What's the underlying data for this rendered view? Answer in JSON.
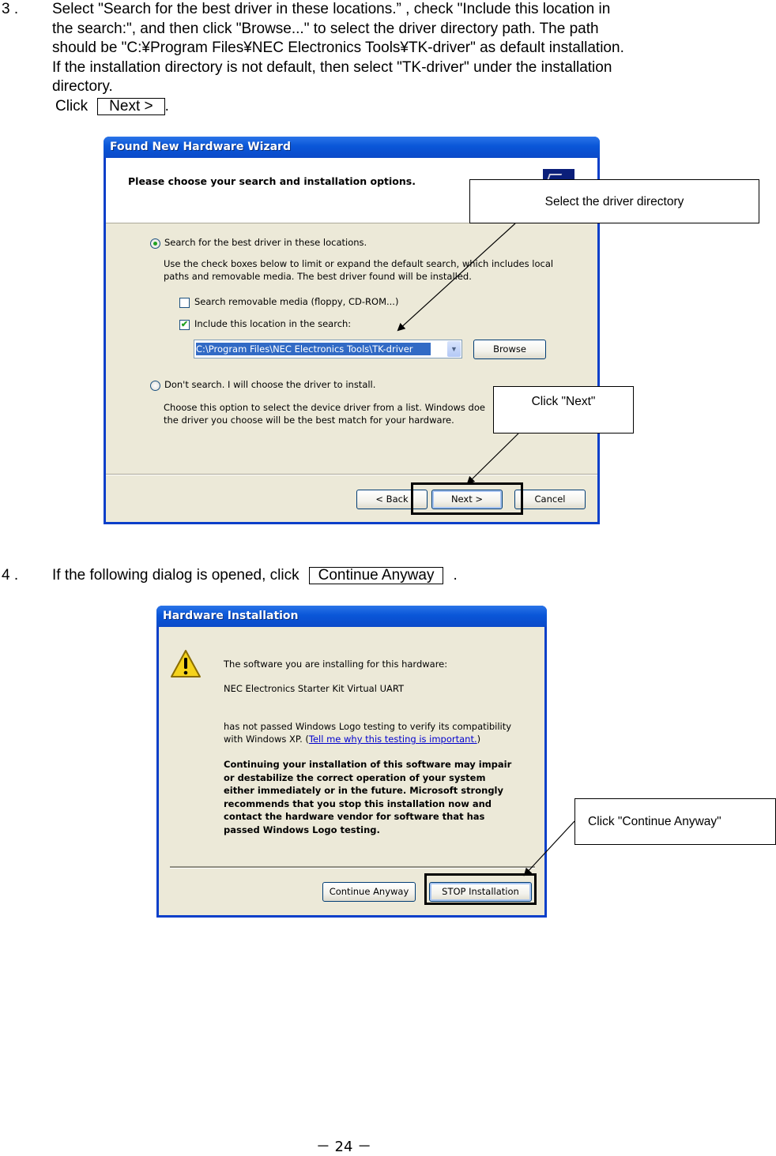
{
  "step3": {
    "number": "3 .",
    "lines": [
      "Select \"Search for the best driver in these locations.” , check \"Include this location in",
      "the search:\", and then click \"Browse...\" to select the driver directory path. The path",
      "should be \"C:¥Program Files¥NEC Electronics Tools¥TK-driver\" as default installation.",
      "If the installation directory is not default, then select \"TK-driver\" under the installation",
      "directory."
    ],
    "click_prefix": "Click",
    "click_button": "Next >",
    "click_suffix": "."
  },
  "wizard": {
    "title": "Found New Hardware Wizard",
    "header": "Please choose your search and installation options.",
    "option_search": {
      "label": "Search for the best driver in these locations.",
      "selected": true,
      "description": [
        "Use the check boxes below to limit or expand the default search, which includes local",
        "paths and removable media. The best driver found will be installed."
      ]
    },
    "checkbox_removable": {
      "label": "Search removable media (floppy, CD-ROM...)",
      "checked": false
    },
    "checkbox_location": {
      "label": "Include this location in the search:",
      "checked": true
    },
    "path_value": "C:\\Program Files\\NEC Electronics Tools\\TK-driver",
    "browse_label": "Browse",
    "option_dont_search": {
      "label": "Don't search. I will choose the driver to install.",
      "selected": false,
      "description": [
        "Choose this option to select the device driver from a list.  Windows doe",
        "the driver you choose will be the best match for your hardware."
      ]
    },
    "buttons": {
      "back": "< Back",
      "next": "Next >",
      "cancel": "Cancel"
    }
  },
  "callouts": {
    "driver_dir": "Select the driver directory",
    "click_next": "Click \"Next\"",
    "continue_anyway": "Click \"Continue Anyway\""
  },
  "step4": {
    "number": "4 .",
    "text": "If the following dialog is opened, click",
    "button": "Continue Anyway",
    "suffix": "."
  },
  "hw_dialog": {
    "title": "Hardware Installation",
    "line1": "The software you are installing for this hardware:",
    "device": "NEC Electronics Starter Kit Virtual UART",
    "logo_line1": "has not passed Windows Logo testing to verify its compatibility",
    "logo_line2_prefix": "with Windows XP. (",
    "logo_link": "Tell me why this testing is important.",
    "logo_line2_suffix": ")",
    "warning": [
      "Continuing your installation of this software may impair",
      "or destabilize the correct operation of your system",
      "either immediately or in the future. Microsoft strongly",
      "recommends that you stop this installation now and",
      "contact the hardware vendor for software that has",
      "passed Windows Logo testing."
    ],
    "buttons": {
      "continue": "Continue Anyway",
      "stop": "STOP Installation"
    }
  },
  "page_number": "－ 24 －",
  "colors": {
    "xp_blue": "#0a56d8",
    "xp_face": "#ece9d8",
    "link": "#0000cc",
    "selection": "#316ac5"
  }
}
